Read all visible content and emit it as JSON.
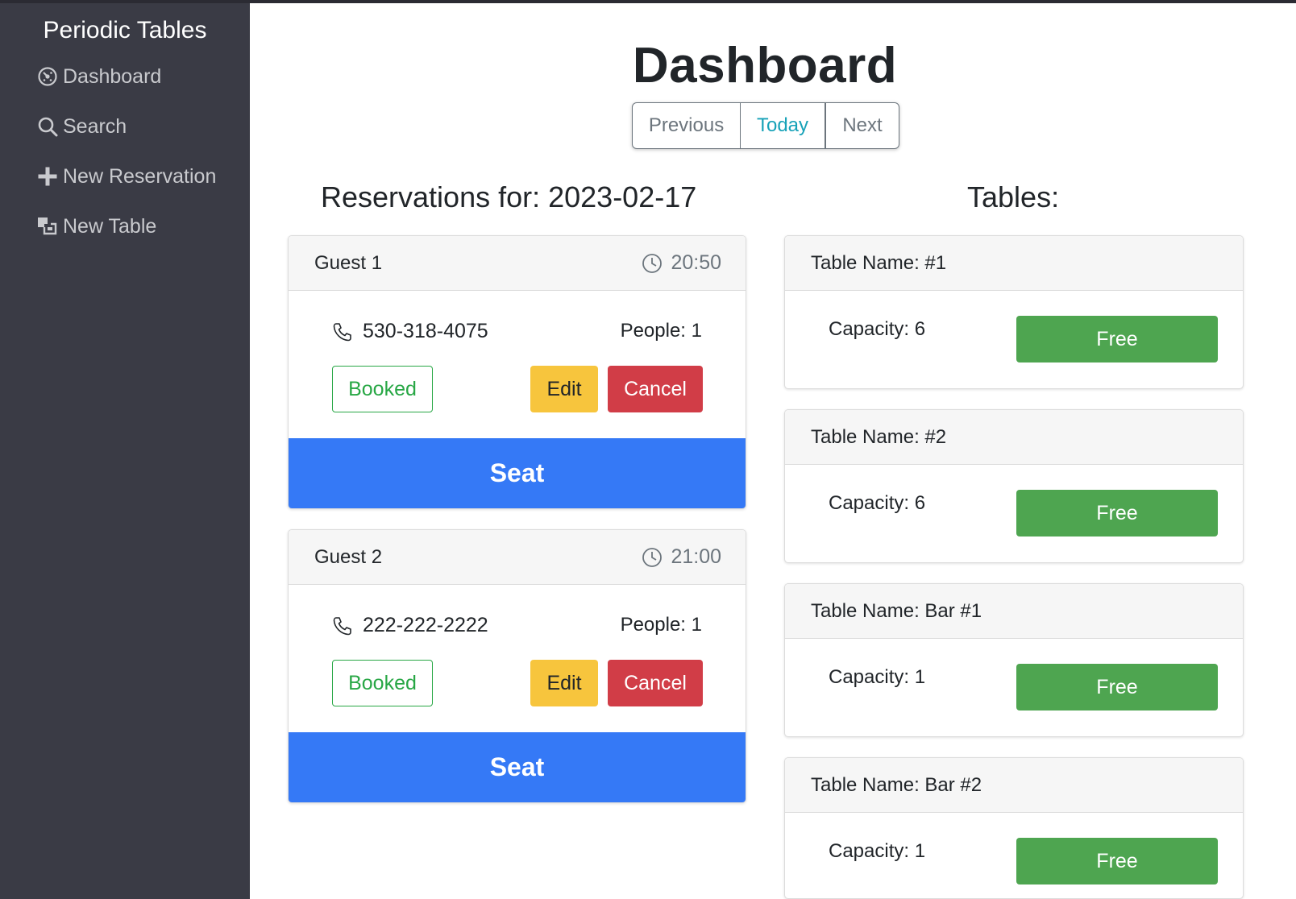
{
  "sidebar": {
    "brand": "Periodic Tables",
    "items": [
      {
        "label": "Dashboard",
        "icon": "dashboard-icon"
      },
      {
        "label": "Search",
        "icon": "search-icon"
      },
      {
        "label": "New Reservation",
        "icon": "plus-icon"
      },
      {
        "label": "New Table",
        "icon": "layers-icon"
      }
    ]
  },
  "header": {
    "title": "Dashboard",
    "nav": {
      "previous": "Previous",
      "today": "Today",
      "next": "Next"
    }
  },
  "reservations": {
    "heading": "Reservations for: 2023-02-17",
    "items": [
      {
        "name": "Guest 1",
        "time": "20:50",
        "phone": "530-318-4075",
        "people": "People: 1",
        "status": "Booked",
        "edit": "Edit",
        "cancel": "Cancel",
        "seat": "Seat"
      },
      {
        "name": "Guest 2",
        "time": "21:00",
        "phone": "222-222-2222",
        "people": "People: 1",
        "status": "Booked",
        "edit": "Edit",
        "cancel": "Cancel",
        "seat": "Seat"
      }
    ]
  },
  "tables": {
    "heading": "Tables:",
    "items": [
      {
        "name": "Table Name: #1",
        "capacity": "Capacity: 6",
        "status": "Free"
      },
      {
        "name": "Table Name: #2",
        "capacity": "Capacity: 6",
        "status": "Free"
      },
      {
        "name": "Table Name: Bar #1",
        "capacity": "Capacity: 1",
        "status": "Free"
      },
      {
        "name": "Table Name: Bar #2",
        "capacity": "Capacity: 1",
        "status": "Free"
      }
    ]
  },
  "colors": {
    "sidebar_bg": "#3a3b45",
    "seat_blue": "#3579f6",
    "free_green": "#4ea550",
    "edit_yellow": "#f7c53d",
    "cancel_red": "#d13d47",
    "booked_green": "#28a745",
    "today_teal": "#17a2b8"
  }
}
